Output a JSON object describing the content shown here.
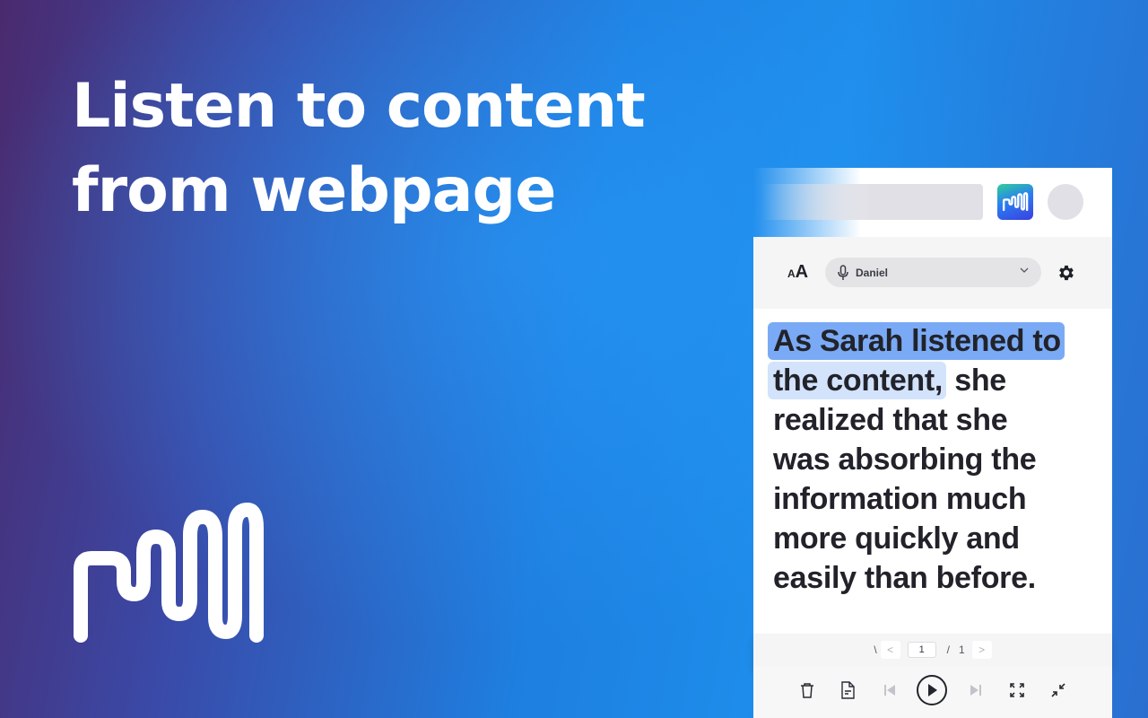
{
  "headline": {
    "line1": "Listen to content",
    "line2": "from webpage"
  },
  "colors": {
    "highlight_sentence": "#7aaaf5",
    "highlight_word": "#d3e3fc",
    "text": "#22232a",
    "toolbar_bg": "#f5f5f6"
  },
  "browser": {
    "extension_icon": "sound-wave-logo-icon",
    "avatar": "avatar"
  },
  "toolbar": {
    "font_size_small": "A",
    "font_size_large": "A",
    "voice_icon": "microphone-icon",
    "voice_selected": "Daniel",
    "settings_icon": "gear-icon"
  },
  "reading": {
    "sentence_highlight": "As Sarah listened to",
    "word_highlight": "the content,",
    "after_highlight": " she",
    "lines": [
      "realized that she",
      "was absorbing the",
      "information much",
      "more quickly and",
      "easily than before."
    ]
  },
  "pager": {
    "mark": "\\",
    "prev": "<",
    "current_page": "1",
    "separator": "/",
    "total_pages": "1",
    "next": ">"
  },
  "controls": [
    {
      "name": "delete",
      "icon": "trash-icon"
    },
    {
      "name": "document",
      "icon": "document-icon"
    },
    {
      "name": "skip-back",
      "icon": "skip-back-icon"
    },
    {
      "name": "play",
      "icon": "play-icon"
    },
    {
      "name": "skip-forward",
      "icon": "skip-forward-icon"
    },
    {
      "name": "expand",
      "icon": "expand-icon"
    },
    {
      "name": "collapse",
      "icon": "collapse-icon"
    }
  ]
}
